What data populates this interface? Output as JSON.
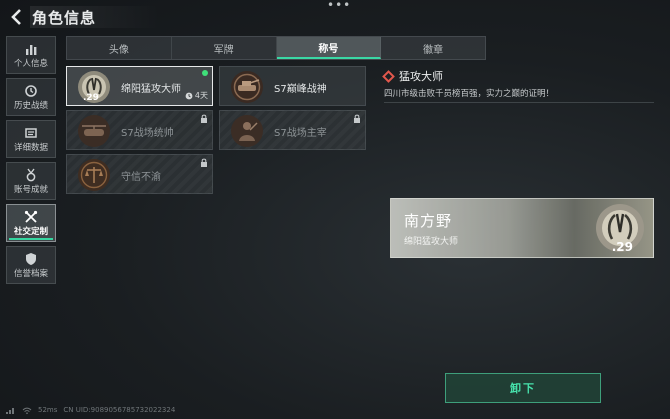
{
  "header": {
    "title": "角色信息"
  },
  "sidebar": {
    "items": [
      {
        "label": "个人信息",
        "icon": "bar-chart-icon"
      },
      {
        "label": "历史战绩",
        "icon": "history-icon"
      },
      {
        "label": "详细数据",
        "icon": "data-icon"
      },
      {
        "label": "账号成就",
        "icon": "medal-icon"
      },
      {
        "label": "社交定制",
        "icon": "tools-icon",
        "active": true
      },
      {
        "label": "信誉档案",
        "icon": "shield-icon"
      }
    ]
  },
  "tabs": [
    {
      "label": "头像"
    },
    {
      "label": "军牌"
    },
    {
      "label": "称号",
      "active": true
    },
    {
      "label": "徽章"
    }
  ],
  "titles": [
    {
      "name": "绵阳猛攻大师",
      "level": ".29",
      "days": "4天",
      "selected": true,
      "equipped": true
    },
    {
      "name": "S7巅峰战神",
      "locked": false
    },
    {
      "name": "S7战场统帅",
      "locked": true
    },
    {
      "name": "S7战场主宰",
      "locked": true
    },
    {
      "name": "守信不渝",
      "locked": true
    }
  ],
  "detail": {
    "title": "猛攻大师",
    "description": "四川市级击败千员榜百强，实力之巅的证明！",
    "card_name": "南方野",
    "card_title": "绵阳猛攻大师",
    "card_level": ".29",
    "button_label": "卸下"
  },
  "status": {
    "ping": "52ms",
    "uid": "CN UID:9089056785732022324"
  },
  "colors": {
    "accent": "#3ad8a5",
    "diamond": "#e2574c",
    "equipped_dot": "#3fe07a"
  }
}
